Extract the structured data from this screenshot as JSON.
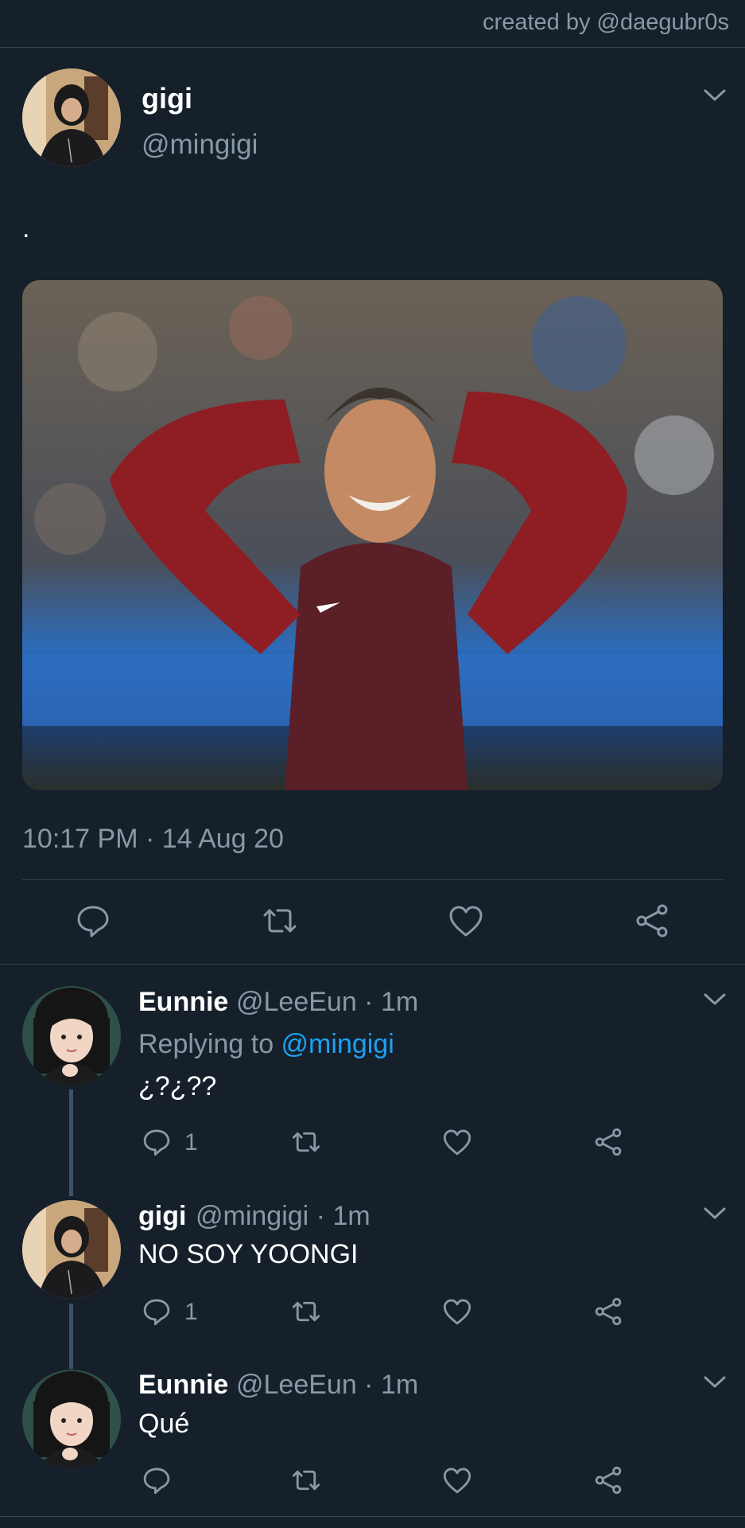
{
  "credit": "created by @daegubr0s",
  "tweet": {
    "name": "gigi",
    "handle": "@mingigi",
    "text": ".",
    "timestamp": "10:17 PM · 14 Aug 20"
  },
  "icons": {
    "reply": "reply-icon",
    "retweet": "retweet-icon",
    "like": "heart-icon",
    "share": "share-icon",
    "more": "chevron-down-icon"
  },
  "replies": [
    {
      "name": "Eunnie",
      "meta": "@LeeEun · 1m",
      "replying_prefix": "Replying to ",
      "replying_handle": "@mingigi",
      "text": "¿?¿??",
      "reply_count": "1"
    },
    {
      "name": "gigi",
      "meta": "@mingigi · 1m",
      "text": "NO SOY YOONGI",
      "reply_count": "1"
    },
    {
      "name": "Eunnie",
      "meta": "@LeeEun · 1m",
      "text": "Qué",
      "reply_count": ""
    }
  ],
  "colors": {
    "background": "#15202b",
    "divider": "#38444d",
    "secondary_text": "#8899a6",
    "accent": "#1da1f2"
  }
}
